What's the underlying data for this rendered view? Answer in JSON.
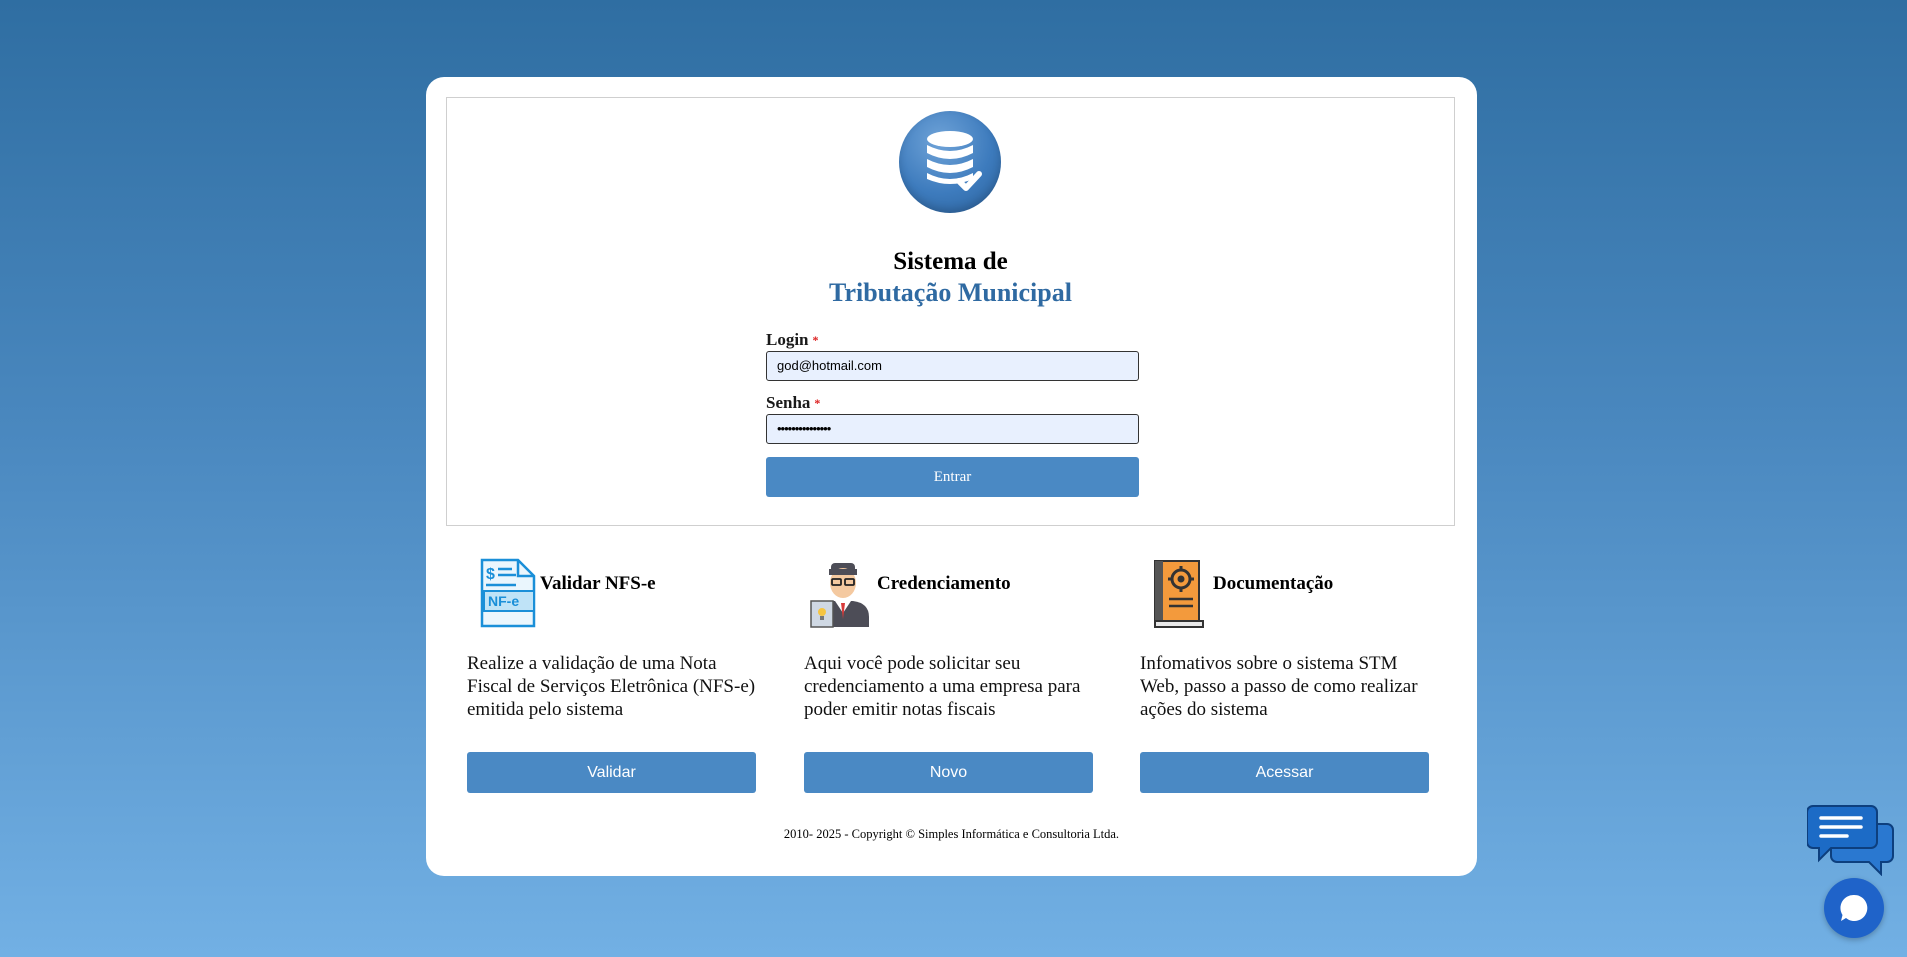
{
  "header": {
    "title_line1": "Sistema de",
    "title_line2": "Tributação Municipal",
    "logo_icon": "database-check-icon"
  },
  "login_form": {
    "login_label": "Login",
    "login_required": "*",
    "login_value": "god@hotmail.com",
    "password_label": "Senha",
    "password_required": "*",
    "password_value": "•••••••••••••••",
    "submit_label": "Entrar"
  },
  "features": [
    {
      "icon": "nfe-document-icon",
      "title": "Validar NFS-e",
      "description": "Realize a validação de uma Nota Fiscal de Serviços Eletrônica (NFS-e) emitida pelo sistema",
      "button": "Validar"
    },
    {
      "icon": "businessman-icon",
      "title": "Credenciamento",
      "description": "Aqui você pode solicitar seu credenciamento a uma empresa para poder emitir notas fiscais",
      "button": "Novo"
    },
    {
      "icon": "gear-book-icon",
      "title": "Documentação",
      "description": "Infomativos sobre o sistema STM Web, passo a passo de como realizar ações do sistema",
      "button": "Acessar"
    }
  ],
  "footer": {
    "copyright": "2010- 2025 - Copyright © Simples Informática e Consultoria Ltda."
  },
  "chat": {
    "bubble_icon": "chat-bubbles-icon",
    "launcher_icon": "chat-launcher-icon"
  },
  "colors": {
    "accent": "#4a89c4",
    "title_blue": "#2f6aa2",
    "required": "#dd2222"
  }
}
